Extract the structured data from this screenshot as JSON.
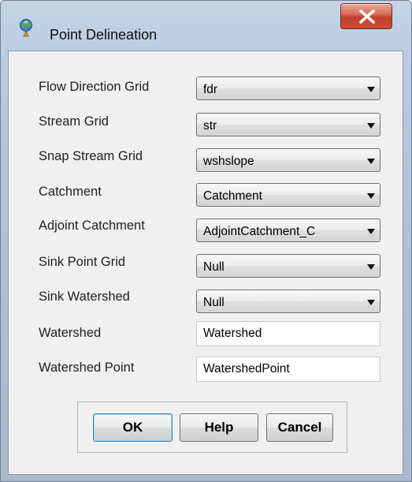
{
  "window": {
    "title": "Point Delineation",
    "icon": "globe-pin-icon",
    "close_label": "X"
  },
  "form": {
    "rows": [
      {
        "label": "Flow Direction Grid",
        "value": "fdr",
        "control": "dropdown"
      },
      {
        "label": "Stream Grid",
        "value": "str",
        "control": "dropdown"
      },
      {
        "label": "Snap Stream Grid",
        "value": "wshslope",
        "control": "dropdown"
      },
      {
        "label": "Catchment",
        "value": "Catchment",
        "control": "dropdown"
      },
      {
        "label": "Adjoint Catchment",
        "value": "AdjointCatchment_C",
        "control": "dropdown"
      },
      {
        "label": "Sink Point Grid",
        "value": "Null",
        "control": "dropdown"
      },
      {
        "label": "Sink Watershed",
        "value": "Null",
        "control": "dropdown"
      },
      {
        "label": "Watershed",
        "value": "Watershed",
        "control": "textbox"
      },
      {
        "label": "Watershed Point",
        "value": "WatershedPoint",
        "control": "textbox"
      }
    ]
  },
  "buttons": {
    "ok": "OK",
    "help": "Help",
    "cancel": "Cancel"
  },
  "colors": {
    "frame": "#bccde3",
    "client": "#f0f0f0",
    "close_button": "#c94d36",
    "default_button_border": "#3c7fb1"
  }
}
